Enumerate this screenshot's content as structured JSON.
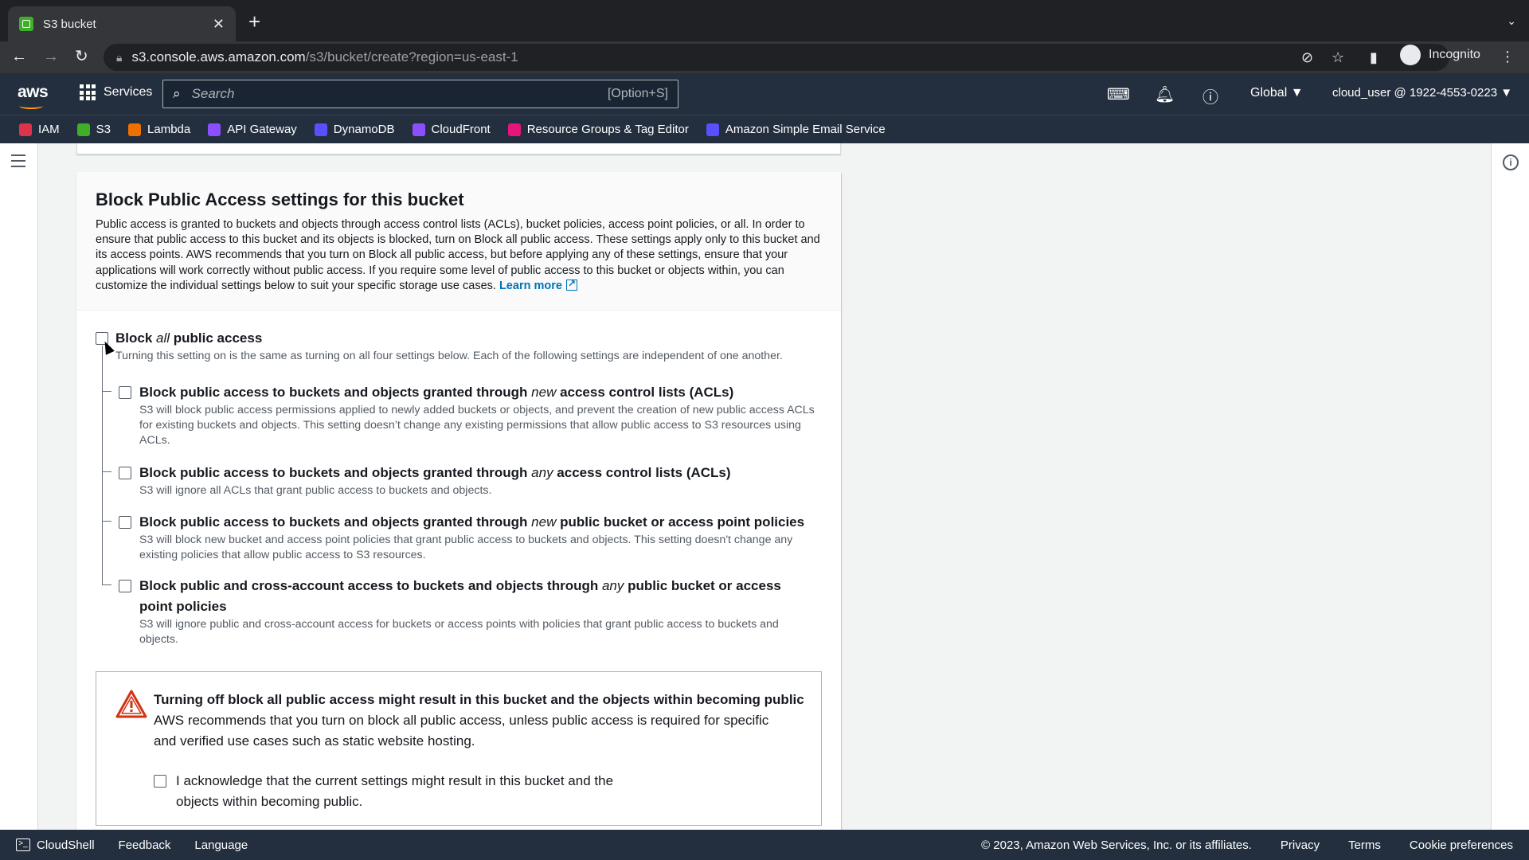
{
  "browser": {
    "tab_title": "S3 bucket",
    "url_host": "s3.console.aws.amazon.com",
    "url_path": "/s3/bucket/create?region=us-east-1",
    "profile_label": "Incognito"
  },
  "aws_nav": {
    "logo": "aws",
    "services_label": "Services",
    "search_placeholder": "Search",
    "search_shortcut": "[Option+S]",
    "region": "Global ▼",
    "account": "cloud_user @ 1922-4553-0223 ▼"
  },
  "favorites": [
    {
      "label": "IAM",
      "color": "#dd344c"
    },
    {
      "label": "S3",
      "color": "#3fae29"
    },
    {
      "label": "Lambda",
      "color": "#ed7100"
    },
    {
      "label": "API Gateway",
      "color": "#8c4fff"
    },
    {
      "label": "DynamoDB",
      "color": "#5a4fff"
    },
    {
      "label": "CloudFront",
      "color": "#8c4fff"
    },
    {
      "label": "Resource Groups & Tag Editor",
      "color": "#e7157b"
    },
    {
      "label": "Amazon Simple Email Service",
      "color": "#5a4fff"
    }
  ],
  "panel": {
    "heading": "Block Public Access settings for this bucket",
    "description": "Public access is granted to buckets and objects through access control lists (ACLs), bucket policies, access point policies, or all. In order to ensure that public access to this bucket and its objects is blocked, turn on Block all public access. These settings apply only to this bucket and its access points. AWS recommends that you turn on Block all public access, but before applying any of these settings, ensure that your applications will work correctly without public access. If you require some level of public access to this bucket or objects within, you can customize the individual settings below to suit your specific storage use cases.",
    "learn_more": "Learn more",
    "block_all": {
      "title_pre": "Block ",
      "title_em": "all",
      "title_post": " public access",
      "desc": "Turning this setting on is the same as turning on all four settings below. Each of the following settings are independent of one another."
    },
    "options": [
      {
        "title_pre": "Block public access to buckets and objects granted through ",
        "title_em": "new",
        "title_post": " access control lists (ACLs)",
        "desc": "S3 will block public access permissions applied to newly added buckets or objects, and prevent the creation of new public access ACLs for existing buckets and objects. This setting doesn’t change any existing permissions that allow public access to S3 resources using ACLs."
      },
      {
        "title_pre": "Block public access to buckets and objects granted through ",
        "title_em": "any",
        "title_post": " access control lists (ACLs)",
        "desc": "S3 will ignore all ACLs that grant public access to buckets and objects."
      },
      {
        "title_pre": "Block public access to buckets and objects granted through ",
        "title_em": "new",
        "title_post": " public bucket or access point policies",
        "desc": "S3 will block new bucket and access point policies that grant public access to buckets and objects. This setting doesn't change any existing policies that allow public access to S3 resources."
      },
      {
        "title_pre": "Block public and cross-account access to buckets and objects through ",
        "title_em": "any",
        "title_post": " public bucket or access point policies",
        "desc": "S3 will ignore public and cross-account access for buckets or access points with policies that grant public access to buckets and objects."
      }
    ],
    "warning": {
      "title": "Turning off block all public access might result in this bucket and the objects within becoming public",
      "text": "AWS recommends that you turn on block all public access, unless public access is required for specific and verified use cases such as static website hosting.",
      "ack": "I acknowledge that the current settings might result in this bucket and the objects within becoming public."
    }
  },
  "footer": {
    "cloudshell": "CloudShell",
    "feedback": "Feedback",
    "language": "Language",
    "copyright": "© 2023, Amazon Web Services, Inc. or its affiliates.",
    "privacy": "Privacy",
    "terms": "Terms",
    "cookies": "Cookie preferences"
  }
}
